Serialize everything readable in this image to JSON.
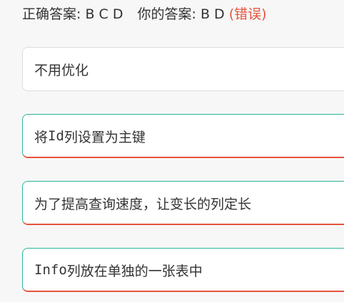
{
  "result": {
    "correct_label": "正确答案:",
    "correct_value": "B C D",
    "yours_label": "你的答案:",
    "yours_value": "B D",
    "status": "(错误)",
    "status_color": "#e5533d"
  },
  "options": [
    {
      "id": "A",
      "text": "不用优化"
    },
    {
      "id": "B",
      "prefix": "将",
      "code": "Id",
      "text": "列设置为主键"
    },
    {
      "id": "C",
      "text": "为了提高查询速度，让变长的列定长"
    },
    {
      "id": "D",
      "code": "Info",
      "text": "列放在单独的一张表中"
    }
  ],
  "colors": {
    "correct_border": "#2bb59a",
    "wrong_accent": "#e5533d",
    "neutral_border": "#dcdcdc"
  }
}
